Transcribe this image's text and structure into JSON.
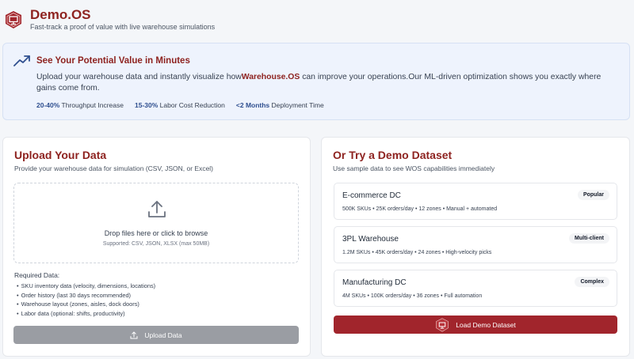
{
  "header": {
    "app_name": "Demo.OS",
    "tagline": "Fast-track a proof of value with live warehouse simulations"
  },
  "banner": {
    "title": "See Your Potential Value in Minutes",
    "body_prefix": "Upload your warehouse data and instantly visualize how",
    "body_brand": "Warehouse.OS",
    "body_suffix": " can improve your operations.Our ML-driven optimization shows you exactly where gains come from.",
    "stats": [
      {
        "value": "20-40%",
        "label": "Throughput Increase"
      },
      {
        "value": "15-30%",
        "label": "Labor Cost Reduction"
      },
      {
        "value": "<2 Months",
        "label": "Deployment Time"
      }
    ]
  },
  "upload": {
    "title": "Upload Your Data",
    "subtitle": "Provide your warehouse data for simulation (CSV, JSON, or Excel)",
    "drop_text": "Drop files here or click to browse",
    "drop_hint": "Supported: CSV, JSON, XLSX (max 50MB)",
    "required_title": "Required Data:",
    "required_items": [
      "SKU inventory data (velocity, dimensions, locations)",
      "Order history (last 30 days recommended)",
      "Warehouse layout (zones, aisles, dock doors)",
      "Labor data (optional: shifts, productivity)"
    ],
    "button_label": "Upload Data"
  },
  "demo": {
    "title": "Or Try a Demo Dataset",
    "subtitle": "Use sample data to see WOS capabilities immediately",
    "datasets": [
      {
        "name": "E-commerce DC",
        "badge": "Popular",
        "meta": "500K SKUs • 25K orders/day • 12 zones • Manual + automated"
      },
      {
        "name": "3PL Warehouse",
        "badge": "Multi-client",
        "meta": "1.2M SKUs • 45K orders/day • 24 zones • High-velocity picks"
      },
      {
        "name": "Manufacturing DC",
        "badge": "Complex",
        "meta": "4M SKUs • 100K orders/day • 36 zones • Full automation"
      }
    ],
    "button_label": "Load Demo Dataset"
  },
  "colors": {
    "brand": "#8e2320",
    "accent_blue": "#2f4f8f",
    "primary_button": "#a1252c",
    "disabled_button": "#9a9da3"
  },
  "icons": {
    "logo": "presentation-shield-icon",
    "banner": "trending-up-icon",
    "dropzone": "upload-icon",
    "upload_button": "upload-icon",
    "demo_button": "presentation-icon"
  }
}
